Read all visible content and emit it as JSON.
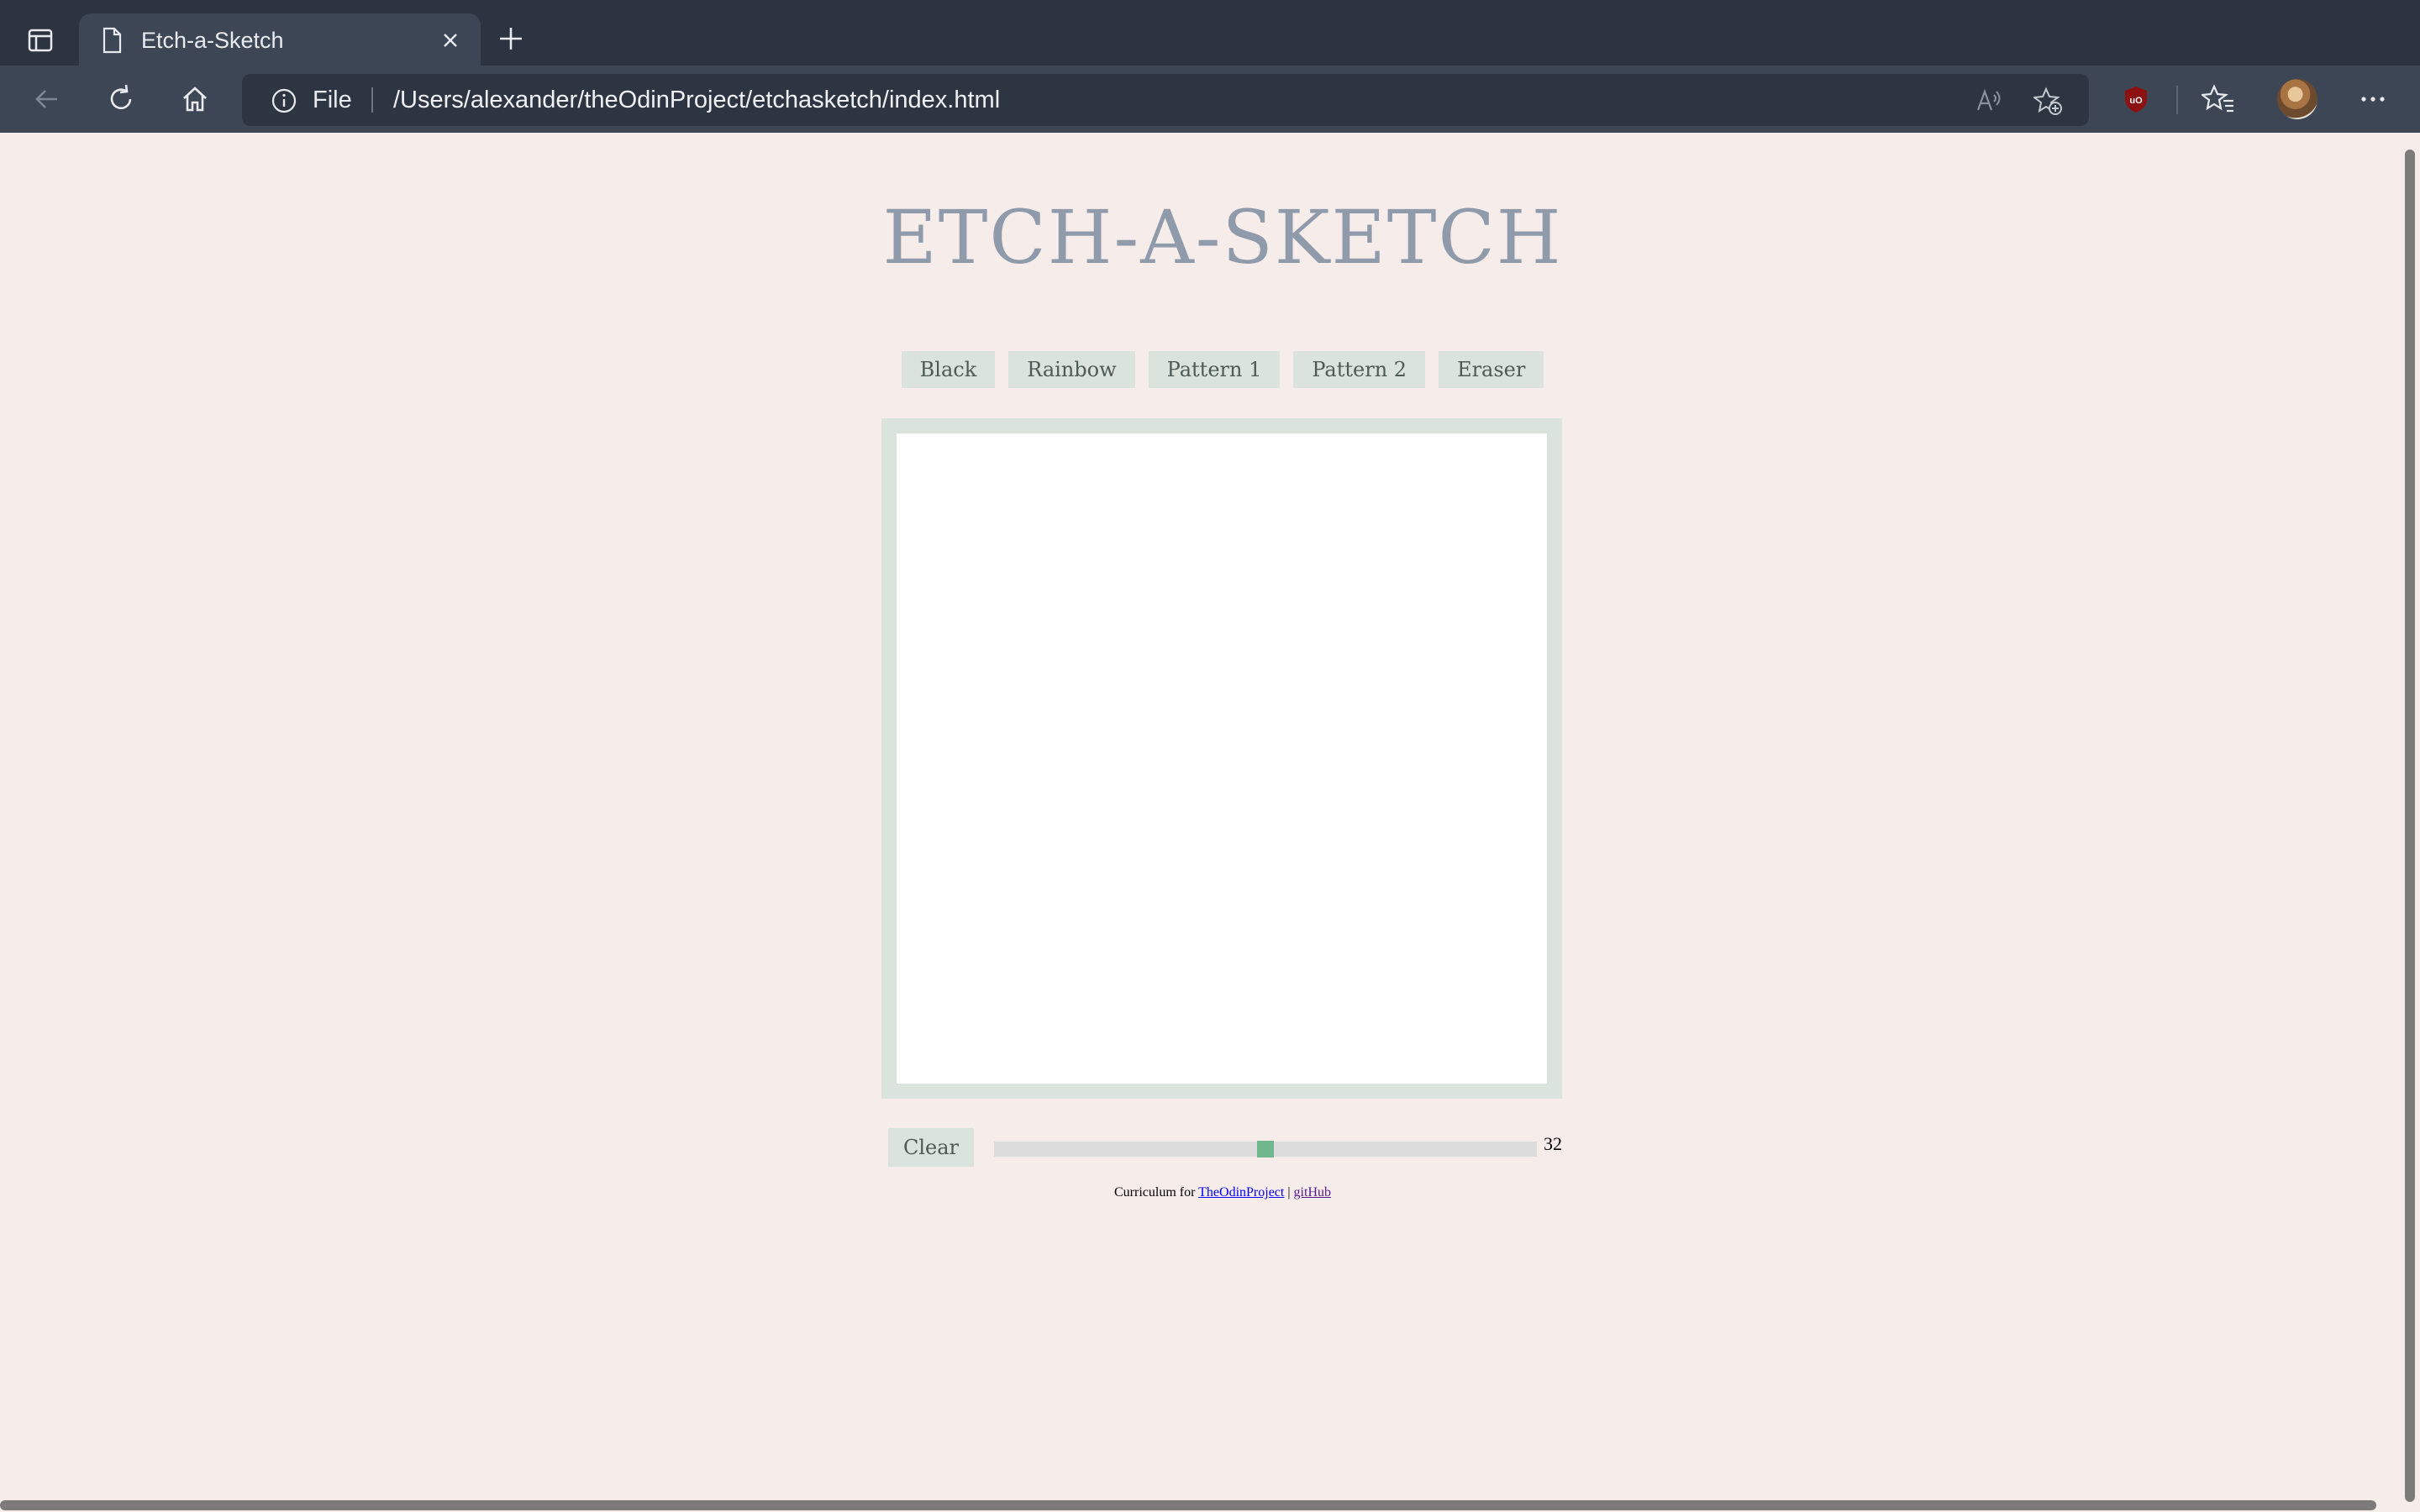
{
  "browser": {
    "tab": {
      "title": "Etch-a-Sketch"
    },
    "address": {
      "scheme": "File",
      "url": "/Users/alexander/theOdinProject/etchasketch/index.html"
    }
  },
  "page": {
    "title": "ETCH-A-SKETCH",
    "modes": [
      {
        "label": "Black"
      },
      {
        "label": "Rainbow"
      },
      {
        "label": "Pattern 1"
      },
      {
        "label": "Pattern 2"
      },
      {
        "label": "Eraser"
      }
    ],
    "clear_label": "Clear",
    "grid_size": {
      "value": "32",
      "min": 1,
      "max": 64,
      "level": 0.5
    },
    "footer": {
      "prefix": "Curriculum for",
      "link1": "TheOdinProject",
      "separator": "|",
      "link2": "gitHub"
    }
  },
  "colors": {
    "background": "#f6ecea",
    "title": "#8f9aab",
    "button_bg": "#dbe3dd",
    "slider_thumb": "#6fb88f"
  }
}
